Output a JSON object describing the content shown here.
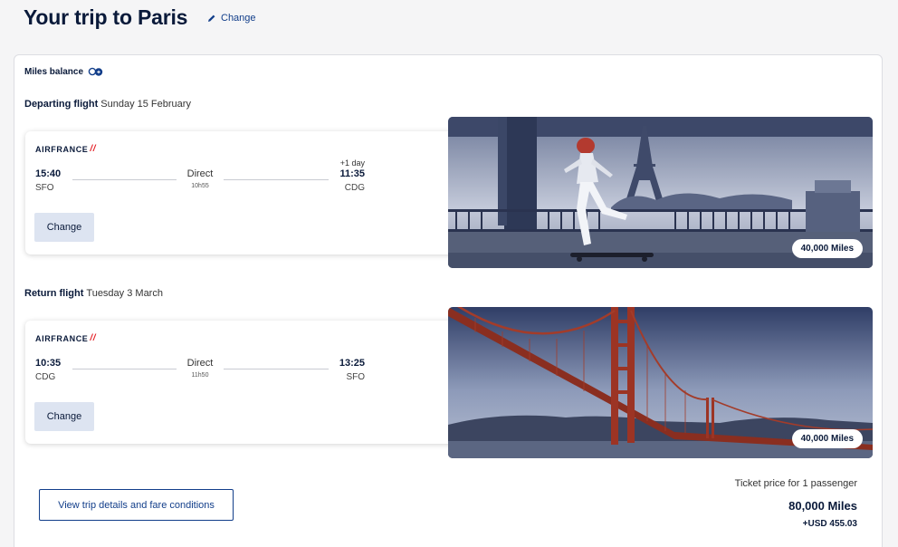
{
  "header": {
    "title": "Your trip to Paris",
    "change_label": "Change"
  },
  "miles_balance": {
    "label": "Miles balance",
    "icon": "miles-coin-icon"
  },
  "departing": {
    "section_label": "Departing flight",
    "date": "Sunday 15 February",
    "airline": "AIRFRANCE",
    "dep_time": "15:40",
    "dep_code": "SFO",
    "arr_time": "11:35",
    "arr_code": "CDG",
    "day_offset": "+1 day",
    "stops": "Direct",
    "duration": "10h55",
    "change_label": "Change",
    "miles": "40,000 Miles"
  },
  "return": {
    "section_label": "Return flight",
    "date": "Tuesday 3 March",
    "airline": "AIRFRANCE",
    "dep_time": "10:35",
    "dep_code": "CDG",
    "arr_time": "13:25",
    "arr_code": "SFO",
    "stops": "Direct",
    "duration": "11h50",
    "change_label": "Change",
    "miles": "40,000 Miles"
  },
  "footer": {
    "details_button": "View trip details and fare conditions",
    "price_caption": "Ticket price for 1 passenger",
    "price_miles": "80,000 Miles",
    "price_usd": "+USD 455.03"
  },
  "colors": {
    "navy": "#0a1a3a",
    "link_blue": "#123e8a",
    "airline_red": "#e4242b",
    "button_bg": "#dde4f1"
  }
}
